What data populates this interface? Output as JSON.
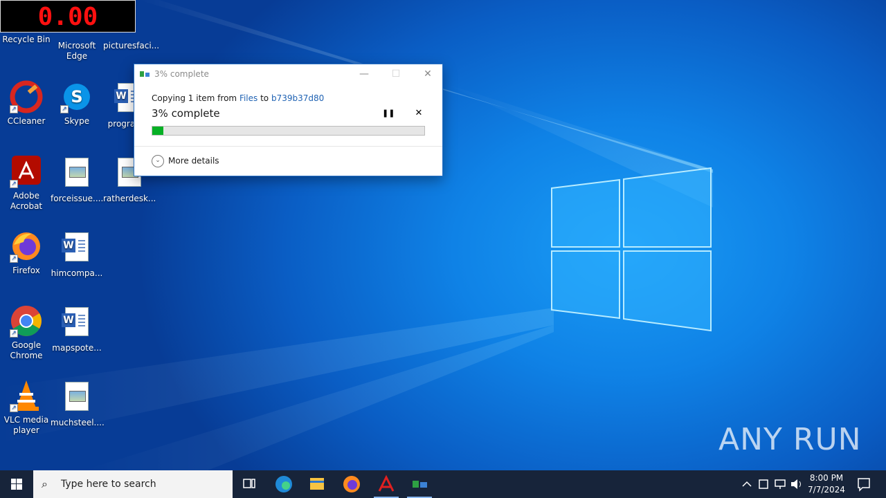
{
  "timer": {
    "value": "0.00"
  },
  "desktop": {
    "icons": [
      {
        "label": "Recycle Bin",
        "icon": "recycle-bin-icon"
      },
      {
        "label": "Microsoft Edge",
        "icon": "edge-icon"
      },
      {
        "label": "picturesfaci...",
        "icon": "document-icon"
      },
      {
        "label": "CCleaner",
        "icon": "ccleaner-icon"
      },
      {
        "label": "Skype",
        "icon": "skype-icon"
      },
      {
        "label": "program...",
        "icon": "word-document-icon"
      },
      {
        "label": "Adobe Acrobat",
        "icon": "acrobat-icon"
      },
      {
        "label": "forceissue....",
        "icon": "image-file-icon"
      },
      {
        "label": "ratherdesk...",
        "icon": "image-file-icon"
      },
      {
        "label": "Firefox",
        "icon": "firefox-icon"
      },
      {
        "label": "himcompa...",
        "icon": "word-document-icon"
      },
      {
        "label": "Google Chrome",
        "icon": "chrome-icon"
      },
      {
        "label": "mapspote...",
        "icon": "word-document-icon"
      },
      {
        "label": "VLC media player",
        "icon": "vlc-icon"
      },
      {
        "label": "muchsteel....",
        "icon": "image-file-icon"
      }
    ]
  },
  "dialog": {
    "title": "3% complete",
    "copy_prefix": "Copying 1 item from ",
    "source": "Files",
    "to_word": " to ",
    "destination": "b739b37d80",
    "status": "3% complete",
    "progress": 0.04,
    "more_details": "More details",
    "minimize_glyph": "—",
    "maximize_glyph": "☐",
    "close_glyph": "✕",
    "pause_glyph": "❚❚",
    "cancel_glyph": "✕"
  },
  "taskbar": {
    "search_placeholder": "Type here to search",
    "apps": [
      "task-view-icon",
      "edge-icon",
      "file-explorer-icon",
      "firefox-icon",
      "acrobat-icon",
      "copy-progress-icon"
    ],
    "clock_time": "8:00 PM",
    "clock_date": "7/7/2024"
  },
  "watermark": {
    "text": "ANY RUN"
  },
  "colors": {
    "accent": "#0a6ed8",
    "progress": "#06b025",
    "link": "#1f62b3",
    "timer": "#ff1010"
  }
}
